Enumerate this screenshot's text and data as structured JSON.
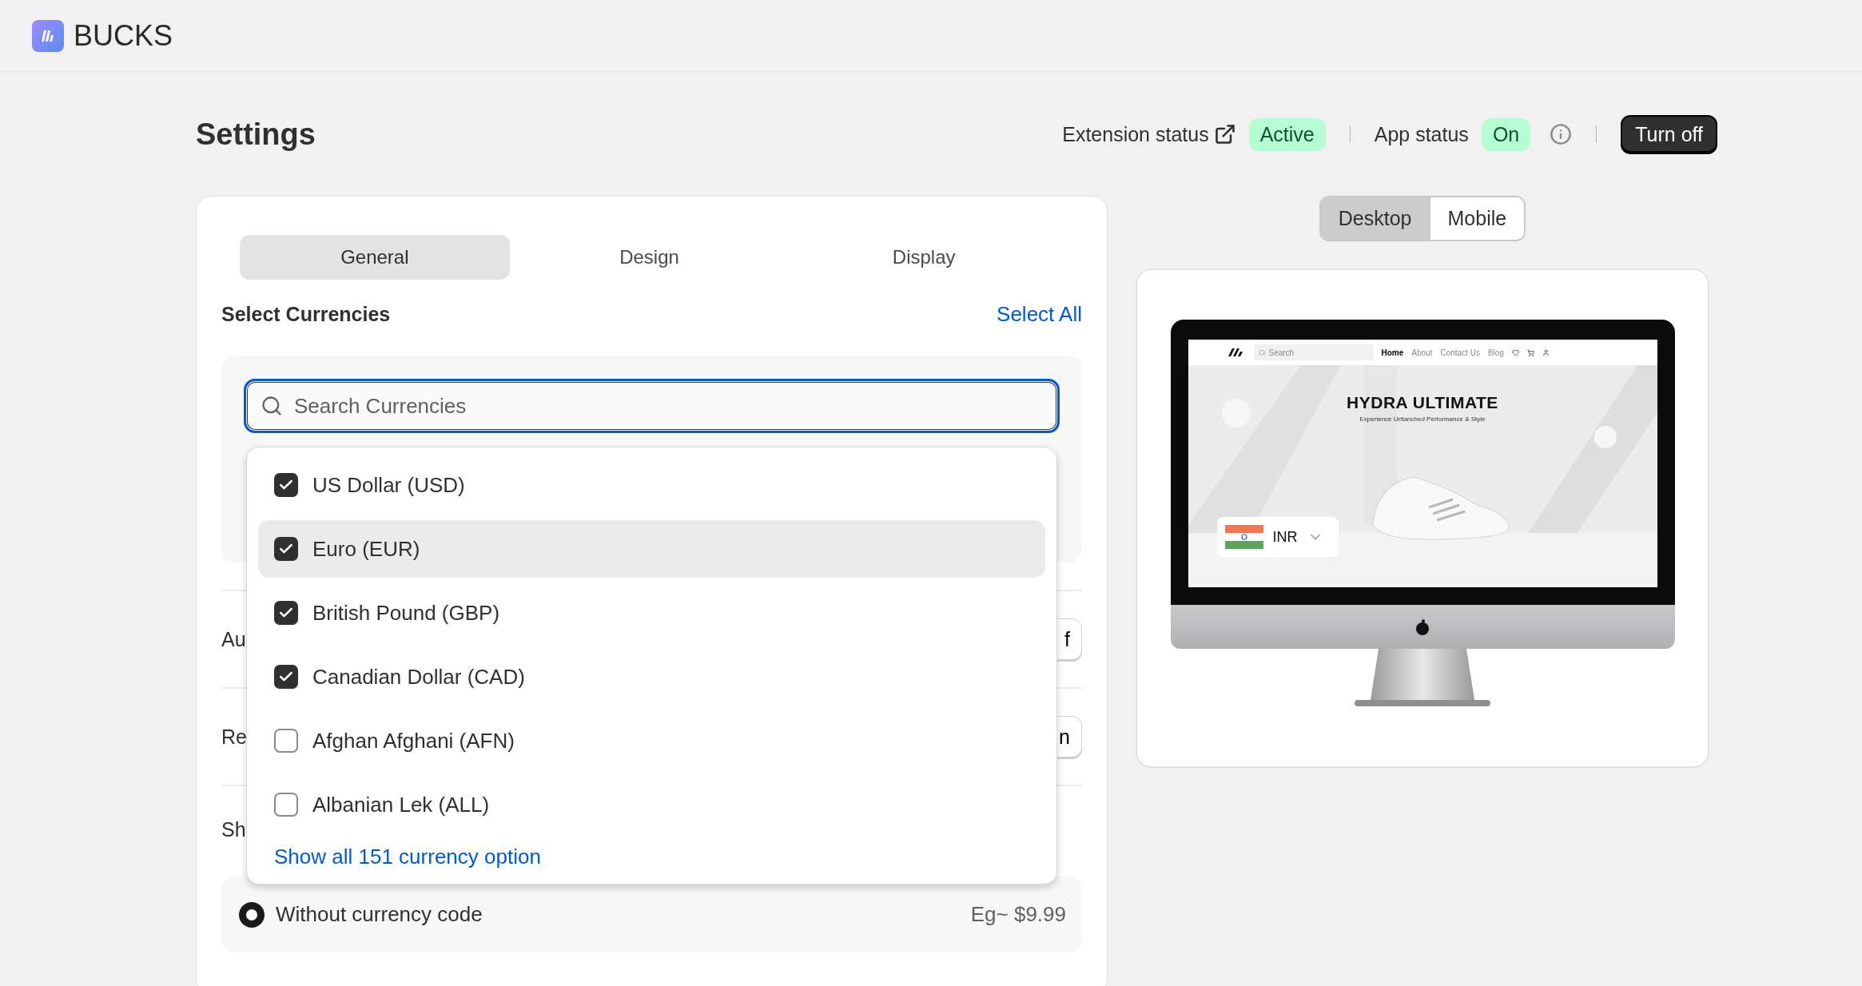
{
  "app": {
    "name": "BUCKS"
  },
  "page": {
    "title": "Settings"
  },
  "status": {
    "extension_label": "Extension status",
    "extension_badge": "Active",
    "app_label": "App status",
    "app_badge": "On",
    "turn_off": "Turn off"
  },
  "tabs": [
    {
      "label": "General",
      "selected": true
    },
    {
      "label": "Design",
      "selected": false
    },
    {
      "label": "Display",
      "selected": false
    }
  ],
  "currencies": {
    "title": "Select Currencies",
    "select_all": "Select All",
    "search": {
      "placeholder": "Search Currencies"
    },
    "options": [
      {
        "label": "US Dollar (USD)",
        "checked": true,
        "selected": false
      },
      {
        "label": "Euro (EUR)",
        "checked": true,
        "selected": true
      },
      {
        "label": "British Pound (GBP)",
        "checked": true,
        "selected": false
      },
      {
        "label": "Canadian Dollar (CAD)",
        "checked": true,
        "selected": false
      },
      {
        "label": "Afghan Afghani (AFN)",
        "checked": false,
        "selected": false
      },
      {
        "label": "Albanian Lek (ALL)",
        "checked": false,
        "selected": false
      }
    ],
    "show_all": "Show all 151 currency option"
  },
  "settings_rows": [
    {
      "label": "Au",
      "button": "f"
    },
    {
      "label": "Re",
      "button": "n"
    }
  ],
  "format_section": {
    "label": "Sh",
    "options": [
      {
        "label": "Without currency code",
        "example": "Eg~ $9.99",
        "selected": true
      }
    ]
  },
  "preview": {
    "views": [
      {
        "label": "Desktop",
        "selected": true
      },
      {
        "label": "Mobile",
        "selected": false
      }
    ],
    "site": {
      "search_placeholder": "Search",
      "nav": [
        {
          "label": "Home",
          "selected": true
        },
        {
          "label": "About",
          "selected": false
        },
        {
          "label": "Contact Us",
          "selected": false
        },
        {
          "label": "Blog",
          "selected": false
        }
      ],
      "headline": "HYDRA ULTIMATE",
      "tagline": "Experience Urttanched Performance & Style",
      "currency": "INR"
    }
  }
}
